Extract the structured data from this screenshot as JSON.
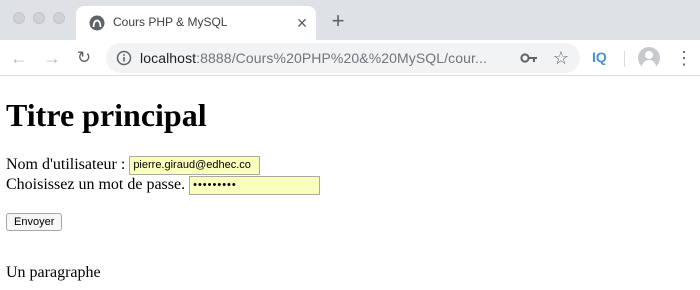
{
  "browser": {
    "tab": {
      "title": "Cours PHP & MySQL",
      "close_glyph": "✕"
    },
    "new_tab_glyph": "+",
    "omnibox": {
      "url_host": "localhost",
      "url_path": ":8888/Cours%20PHP%20&%20MySQL/cour..."
    },
    "extension_label": "IQ",
    "menu_glyph": "⋮",
    "icons": [
      "back-arrow-icon",
      "forward-arrow-icon",
      "reload-icon",
      "info-icon",
      "key-icon",
      "star-icon",
      "avatar-icon",
      "more-menu-icon"
    ]
  },
  "page": {
    "title": "Titre principal",
    "form": {
      "username_label": "Nom d'utilisateur :",
      "username_value": "pierre.giraud@edhec.co",
      "password_label": "Choisissez un mot de passe.",
      "password_value": "•••••••••",
      "autofill_color": "#faffbd",
      "submit_label": "Envoyer"
    },
    "paragraph": "Un paragraphe"
  }
}
